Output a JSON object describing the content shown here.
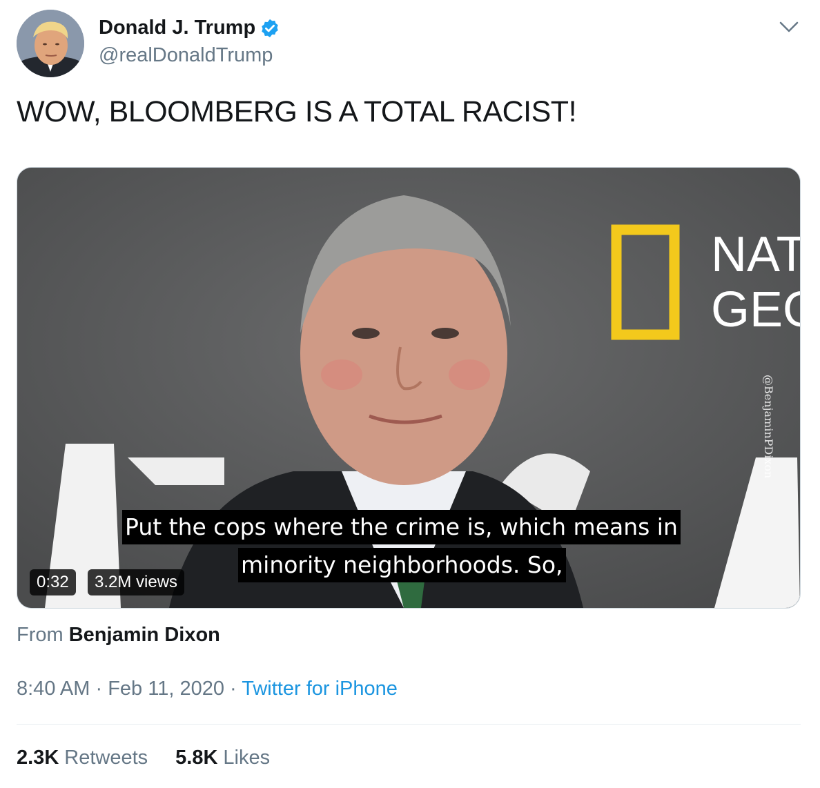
{
  "user": {
    "display_name": "Donald J. Trump",
    "handle": "@realDonaldTrump",
    "verified": true,
    "verified_color": "#1da1f2"
  },
  "tweet": {
    "text": "WOW, BLOOMBERG IS A TOTAL RACIST!"
  },
  "video": {
    "subtitle_line1": "Put the cops where the crime is, which means in",
    "subtitle_line2": "minority neighborhoods. So,",
    "watermark": "@BenjaminPDixon",
    "logo_text_line1": "NAT",
    "logo_text_line2": "GEO",
    "duration": "0:32",
    "views": "3.2M views"
  },
  "attribution": {
    "prefix": "From",
    "name": "Benjamin Dixon"
  },
  "meta": {
    "time": "8:40 AM",
    "date": "Feb 11, 2020",
    "source": "Twitter for iPhone",
    "source_color": "#1b95e0",
    "separator": "·"
  },
  "stats": {
    "retweets_count": "2.3K",
    "retweets_label": "Retweets",
    "likes_count": "5.8K",
    "likes_label": "Likes"
  },
  "icons": [
    "verified-badge-icon",
    "chevron-down-icon"
  ]
}
